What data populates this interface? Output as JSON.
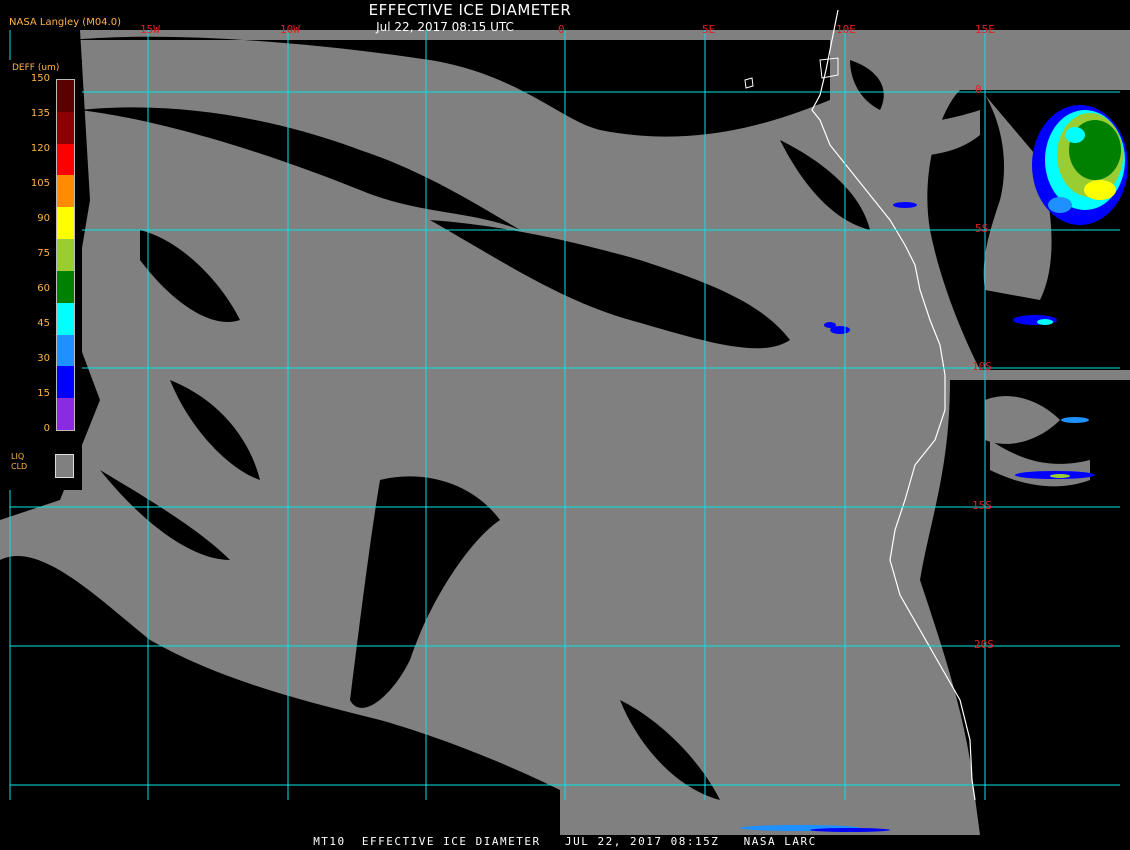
{
  "header": {
    "title": "EFFECTIVE ICE DIAMETER",
    "date": "Jul 22, 2017 08:15 UTC",
    "provider": "NASA Langley (M04.0)"
  },
  "footer": "MT10  EFFECTIVE ICE DIAMETER   JUL 22, 2017 08:15Z   NASA LARC",
  "legend": {
    "unit": "DEFF (um)",
    "ticks": [
      "150",
      "135",
      "120",
      "105",
      "90",
      "75",
      "60",
      "45",
      "30",
      "15",
      "0"
    ],
    "colors": [
      "#5a0000",
      "#8b0000",
      "#ff0000",
      "#ff8c00",
      "#ffff00",
      "#9acd32",
      "#008000",
      "#00ffff",
      "#1e90ff",
      "#0000ff",
      "#8a2be2"
    ],
    "liquid_label_1": "LIQ",
    "liquid_label_2": "CLD",
    "liquid_color": "#808080"
  },
  "grid": {
    "lon_labels": [
      "15W",
      "10W",
      "0",
      "5E",
      "10E",
      "15E"
    ],
    "lat_labels": [
      "0",
      "5S",
      "10S",
      "15S",
      "20S"
    ],
    "color": "#00e5e5"
  },
  "colors": {
    "clear_sky": "#000000",
    "liquid_cloud": "#808080",
    "coastline": "#ffffff",
    "grid_labels": "#e02020"
  }
}
